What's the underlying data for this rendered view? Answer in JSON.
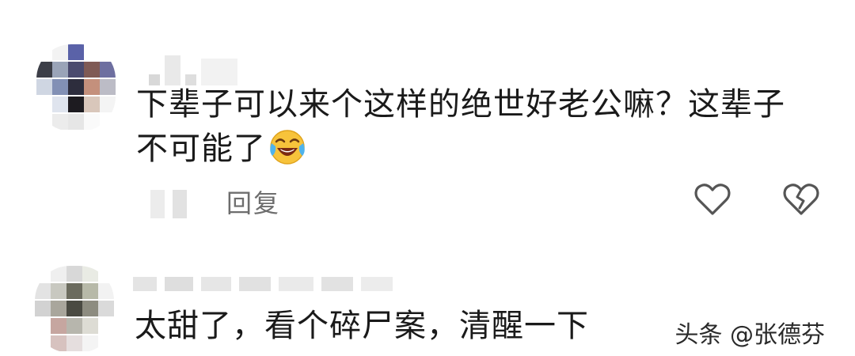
{
  "comments": [
    {
      "text_line1": "下辈子可以来个这样的绝世好老公嘛？这辈子",
      "text_line2": "不可能了",
      "emoji": "laughing-crying-emoji",
      "reply_label": "回复",
      "like_icon": "heart-outline-icon",
      "dislike_icon": "broken-heart-icon"
    },
    {
      "text": "太甜了，看个碎尸案，清醒一下"
    }
  ],
  "watermark": "头条 @张德芬"
}
